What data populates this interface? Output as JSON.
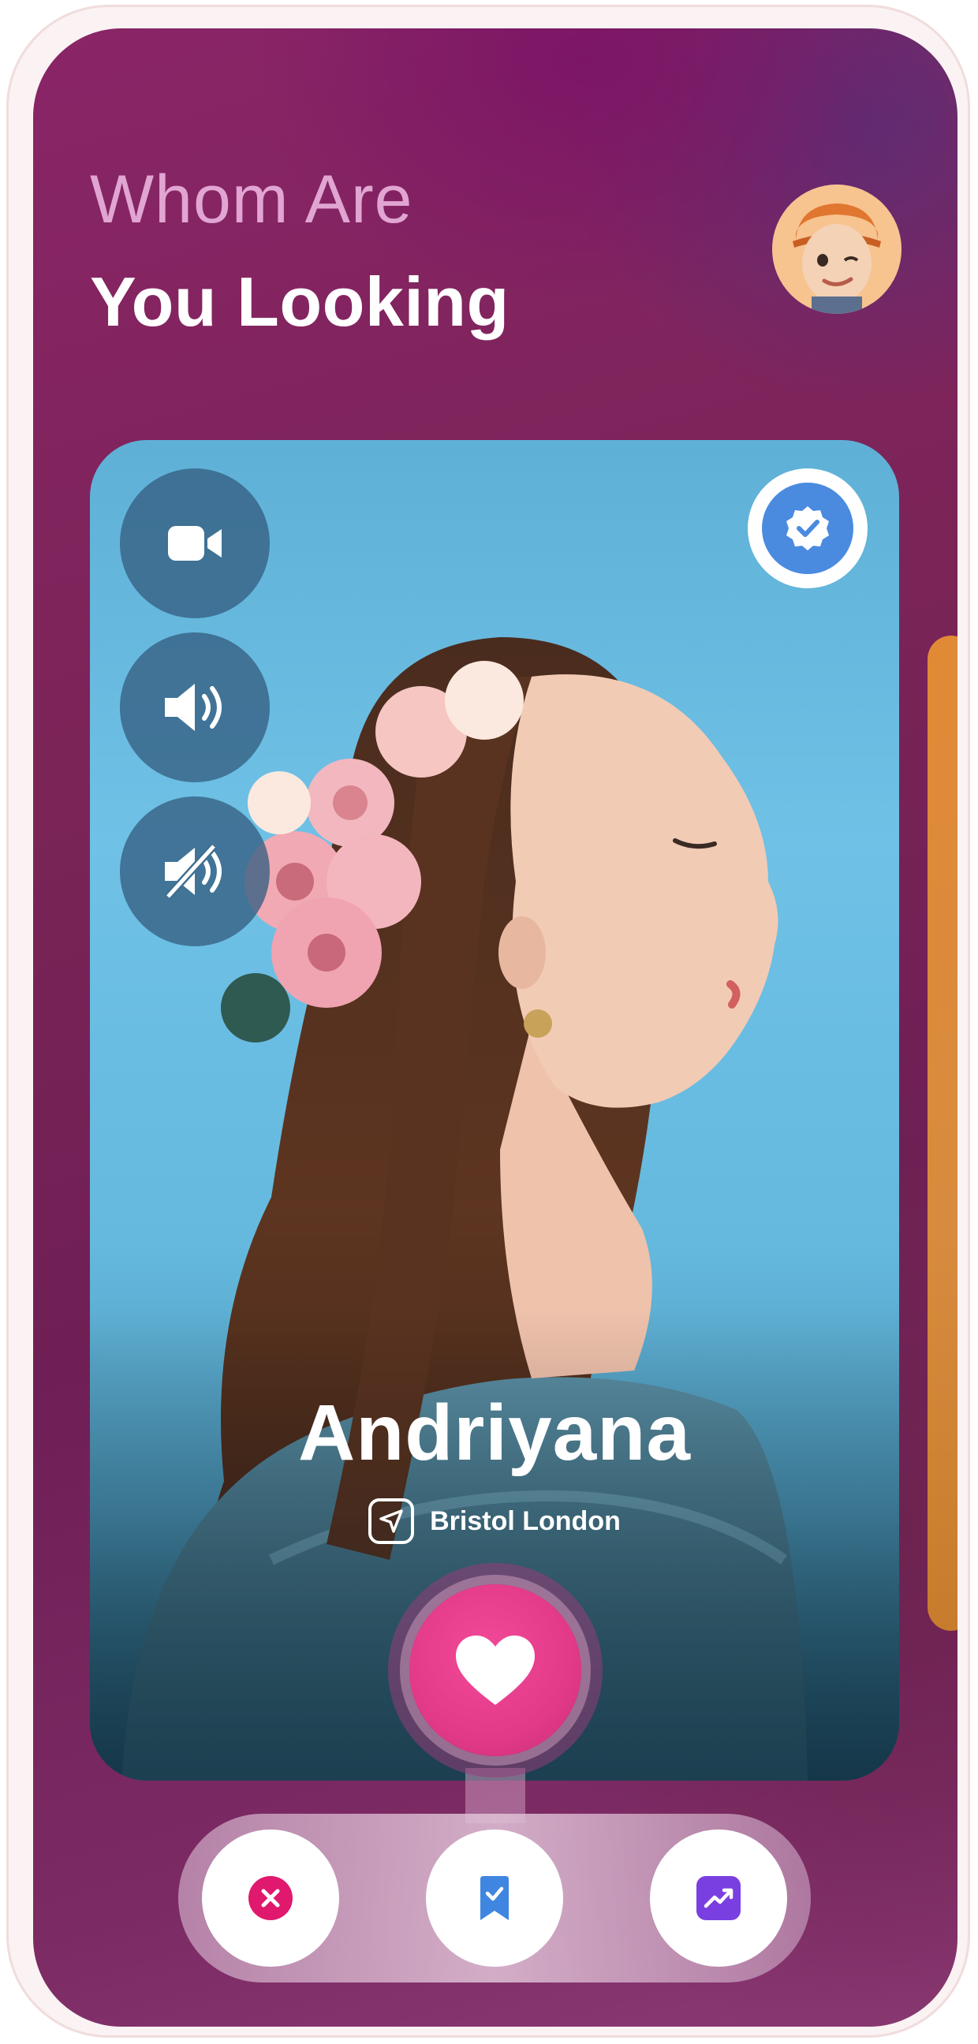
{
  "header": {
    "title_line1": "Whom Are",
    "title_line2": "You Looking"
  },
  "profile": {
    "name": "Andriyana",
    "location": "Bristol London",
    "verified": true
  },
  "controls": [
    {
      "icon": "video-camera-icon"
    },
    {
      "icon": "speaker-icon"
    },
    {
      "icon": "speaker-muted-icon"
    }
  ],
  "actions": {
    "like_icon": "heart-icon",
    "bottom": [
      {
        "icon": "close-icon",
        "color": "#e0186e"
      },
      {
        "icon": "bookmark-icon",
        "color": "#3f86e0"
      },
      {
        "icon": "trending-icon",
        "color": "#7a3fe0"
      }
    ]
  },
  "colors": {
    "background": "#7a2457",
    "title_light": "#e1a5d2",
    "like": "#e23a88",
    "verified": "#4a8be0",
    "card_side_peek": "#d88b3e"
  }
}
